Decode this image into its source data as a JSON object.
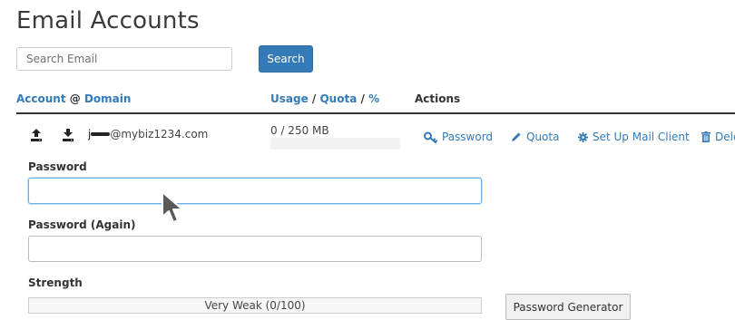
{
  "page": {
    "title": "Email Accounts"
  },
  "search": {
    "placeholder": "Search Email",
    "button_label": "Search"
  },
  "table": {
    "headers": {
      "account": "Account",
      "at": "@",
      "domain": "Domain",
      "usage": "Usage",
      "slash1": "/",
      "quota": "Quota",
      "slash2": "/",
      "percent": "%",
      "actions": "Actions"
    },
    "row": {
      "email_visible": "@mybiz1234.com",
      "email_prefix_glyph": "j",
      "usage_text": "0 / 250 MB",
      "usage_fraction": 0,
      "icons": [
        "upload-icon",
        "download-icon"
      ],
      "actions": [
        {
          "label": "Password",
          "icon": "key-icon"
        },
        {
          "label": "Quota",
          "icon": "pencil-icon"
        },
        {
          "label": "Set Up Mail Client",
          "icon": "gear-icon"
        },
        {
          "label": "Dele",
          "icon": "trash-icon"
        }
      ]
    }
  },
  "password_form": {
    "password_label": "Password",
    "password_value": "",
    "password_again_label": "Password (Again)",
    "password_again_value": "",
    "strength_label": "Strength",
    "strength_text": "Very Weak (0/100)",
    "generator_button": "Password Generator"
  },
  "colors": {
    "link": "#337ab7",
    "primary_button": "#337ab7",
    "heading": "#3a3a3a"
  }
}
